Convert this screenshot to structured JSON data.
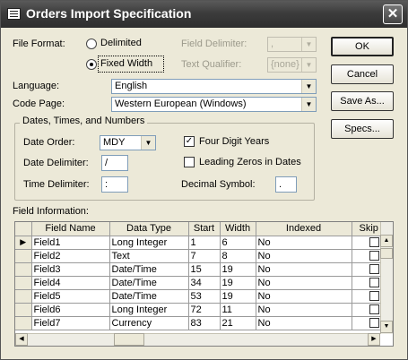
{
  "window": {
    "title": "Orders Import Specification",
    "close_glyph": "✕"
  },
  "file_format": {
    "label": "File Format:",
    "delimited": "Delimited",
    "fixed_width": "Fixed Width",
    "selected": "Fixed Width"
  },
  "field_delimiter": {
    "label": "Field Delimiter:",
    "value": ","
  },
  "text_qualifier": {
    "label": "Text Qualifier:",
    "value": "{none}"
  },
  "language": {
    "label": "Language:",
    "value": "English"
  },
  "code_page": {
    "label": "Code Page:",
    "value": "Western European (Windows)"
  },
  "dates_group": {
    "label": "Dates, Times, and Numbers",
    "date_order_label": "Date Order:",
    "date_order_value": "MDY",
    "date_delimiter_label": "Date Delimiter:",
    "date_delimiter_value": "/",
    "time_delimiter_label": "Time Delimiter:",
    "time_delimiter_value": ":",
    "four_digit_years_label": "Four Digit Years",
    "four_digit_years_checked": true,
    "leading_zeros_label": "Leading Zeros in Dates",
    "leading_zeros_checked": false,
    "decimal_symbol_label": "Decimal Symbol:",
    "decimal_symbol_value": "."
  },
  "buttons": {
    "ok": "OK",
    "cancel": "Cancel",
    "save_as": "Save As...",
    "specs": "Specs..."
  },
  "field_information": {
    "label": "Field Information:",
    "columns": [
      "Field Name",
      "Data Type",
      "Start",
      "Width",
      "Indexed",
      "Skip"
    ],
    "rows": [
      {
        "name": "Field1",
        "type": "Long Integer",
        "start": "1",
        "width": "6",
        "indexed": "No",
        "current": true
      },
      {
        "name": "Field2",
        "type": "Text",
        "start": "7",
        "width": "8",
        "indexed": "No"
      },
      {
        "name": "Field3",
        "type": "Date/Time",
        "start": "15",
        "width": "19",
        "indexed": "No"
      },
      {
        "name": "Field4",
        "type": "Date/Time",
        "start": "34",
        "width": "19",
        "indexed": "No"
      },
      {
        "name": "Field5",
        "type": "Date/Time",
        "start": "53",
        "width": "19",
        "indexed": "No"
      },
      {
        "name": "Field6",
        "type": "Long Integer",
        "start": "72",
        "width": "11",
        "indexed": "No"
      },
      {
        "name": "Field7",
        "type": "Currency",
        "start": "83",
        "width": "21",
        "indexed": "No"
      }
    ],
    "current_row_marker": "▶"
  }
}
